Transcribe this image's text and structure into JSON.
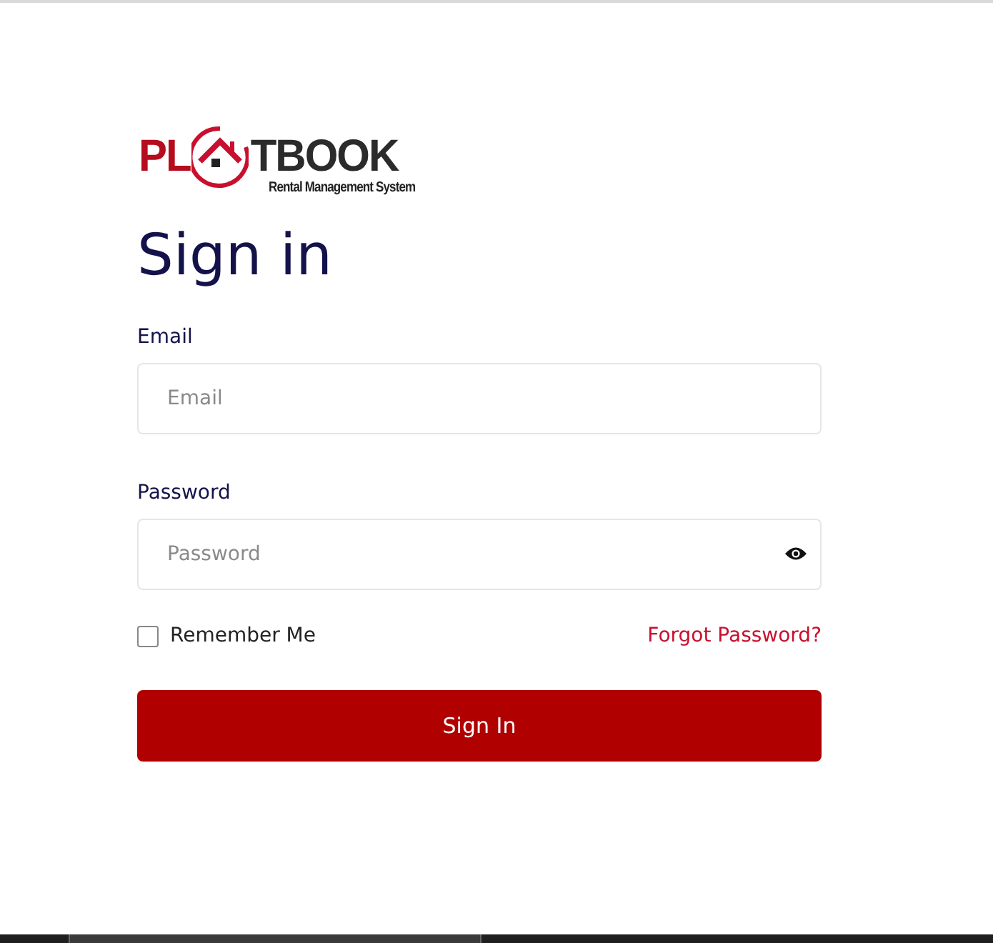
{
  "logo": {
    "left": "PL",
    "right": "TBOOK",
    "tagline": "Rental Management System"
  },
  "title": "Sign in",
  "fields": [
    {
      "label": "Email",
      "placeholder": "Email",
      "kind": "text"
    },
    {
      "label": "Password",
      "placeholder": "Password",
      "kind": "password"
    }
  ],
  "remember": {
    "label": "Remember Me",
    "checked": false
  },
  "forgot_link": "Forgot Password?",
  "submit": "Sign In"
}
